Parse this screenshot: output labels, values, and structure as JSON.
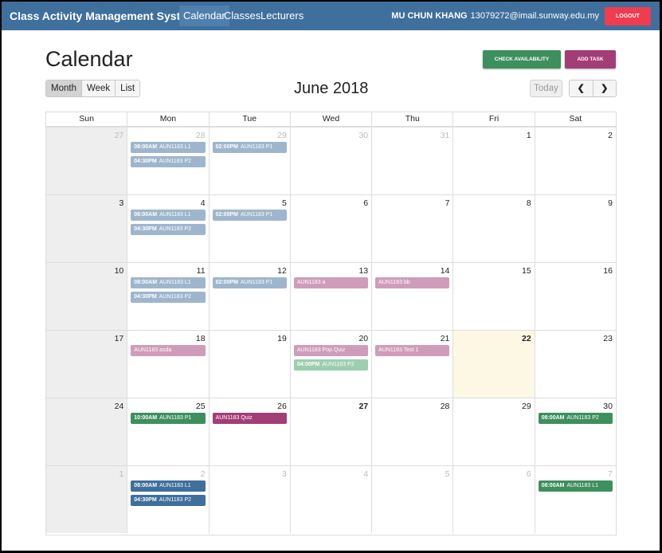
{
  "navbar": {
    "brand": "Class Activity Management System",
    "links": [
      "Calendar",
      "Classes",
      "Lecturers"
    ],
    "user_name": "MU CHUN KHANG",
    "user_email": "13079272@imail.sunway.edu.my",
    "logout_label": "LOGOUT"
  },
  "header": {
    "title": "Calendar",
    "check_availability_label": "CHECK AVAILABILITY",
    "add_task_label": "ADD TASK"
  },
  "toolbar": {
    "views": [
      "Month",
      "Week",
      "List"
    ],
    "active_view": "Month",
    "month_title": "June 2018",
    "today_label": "Today",
    "prev_icon": "chevron-left-icon",
    "next_icon": "chevron-right-icon"
  },
  "calendar": {
    "days_of_week": [
      "Sun",
      "Mon",
      "Tue",
      "Wed",
      "Thu",
      "Fri",
      "Sat"
    ],
    "weeks": [
      [
        {
          "num": "27",
          "other": true,
          "events": []
        },
        {
          "num": "28",
          "other": true,
          "events": [
            {
              "time": "08:00AM",
              "title": "AUN1183 L1",
              "color": "lightblue"
            },
            {
              "time": "04:30PM",
              "title": "AUN1183 P2",
              "color": "lightblue"
            }
          ]
        },
        {
          "num": "29",
          "other": true,
          "events": [
            {
              "time": "02:00PM",
              "title": "AUN1183 P1",
              "color": "lightblue"
            }
          ]
        },
        {
          "num": "30",
          "other": true,
          "events": []
        },
        {
          "num": "31",
          "other": true,
          "events": []
        },
        {
          "num": "1",
          "events": []
        },
        {
          "num": "2",
          "events": []
        }
      ],
      [
        {
          "num": "3",
          "events": []
        },
        {
          "num": "4",
          "events": [
            {
              "time": "08:00AM",
              "title": "AUN1183 L1",
              "color": "lightblue"
            },
            {
              "time": "04:30PM",
              "title": "AUN1183 P2",
              "color": "lightblue"
            }
          ]
        },
        {
          "num": "5",
          "events": [
            {
              "time": "02:00PM",
              "title": "AUN1183 P1",
              "color": "lightblue"
            }
          ]
        },
        {
          "num": "6",
          "events": []
        },
        {
          "num": "7",
          "events": []
        },
        {
          "num": "8",
          "events": []
        },
        {
          "num": "9",
          "events": []
        }
      ],
      [
        {
          "num": "10",
          "events": []
        },
        {
          "num": "11",
          "events": [
            {
              "time": "08:00AM",
              "title": "AUN1183 L1",
              "color": "lightblue"
            },
            {
              "time": "04:30PM",
              "title": "AUN1183 P2",
              "color": "lightblue"
            }
          ]
        },
        {
          "num": "12",
          "events": [
            {
              "time": "02:00PM",
              "title": "AUN1183 P1",
              "color": "lightblue"
            }
          ]
        },
        {
          "num": "13",
          "events": [
            {
              "time": "",
              "title": "AUN1183 a",
              "color": "pink"
            }
          ]
        },
        {
          "num": "14",
          "events": [
            {
              "time": "",
              "title": "AUN1183 bb",
              "color": "pink"
            }
          ]
        },
        {
          "num": "15",
          "events": []
        },
        {
          "num": "16",
          "events": []
        }
      ],
      [
        {
          "num": "17",
          "events": []
        },
        {
          "num": "18",
          "events": [
            {
              "time": "",
              "title": "AUN1183 asda",
              "color": "pink"
            }
          ]
        },
        {
          "num": "19",
          "events": []
        },
        {
          "num": "20",
          "events": [
            {
              "time": "",
              "title": "AUN1183 Pop Quiz",
              "color": "pink"
            },
            {
              "time": "04:00PM",
              "title": "AUN1183 P2",
              "color": "lightgreen"
            }
          ]
        },
        {
          "num": "21",
          "events": [
            {
              "time": "",
              "title": "AUN1183 Test 1",
              "color": "pink"
            }
          ]
        },
        {
          "num": "22",
          "today": true,
          "bold": true,
          "events": []
        },
        {
          "num": "23",
          "events": []
        }
      ],
      [
        {
          "num": "24",
          "events": []
        },
        {
          "num": "25",
          "events": [
            {
              "time": "10:00AM",
              "title": "AUN1183 P1",
              "color": "green"
            }
          ]
        },
        {
          "num": "26",
          "events": [
            {
              "time": "",
              "title": "AUN1183 Quiz",
              "color": "purple"
            }
          ]
        },
        {
          "num": "27",
          "bold": true,
          "events": []
        },
        {
          "num": "28",
          "events": []
        },
        {
          "num": "29",
          "events": []
        },
        {
          "num": "30",
          "events": [
            {
              "time": "08:00AM",
              "title": "AUN1183 P2",
              "color": "green"
            }
          ]
        }
      ],
      [
        {
          "num": "1",
          "other": true,
          "events": []
        },
        {
          "num": "2",
          "other": true,
          "events": [
            {
              "time": "08:00AM",
              "title": "AUN1183 L1",
              "color": "blue"
            },
            {
              "time": "04:30PM",
              "title": "AUN1183 P2",
              "color": "blue"
            }
          ]
        },
        {
          "num": "3",
          "other": true,
          "events": []
        },
        {
          "num": "4",
          "other": true,
          "events": []
        },
        {
          "num": "5",
          "other": true,
          "events": []
        },
        {
          "num": "6",
          "other": true,
          "events": []
        },
        {
          "num": "7",
          "other": true,
          "events": [
            {
              "time": "08:00AM",
              "title": "AUN1183 L1",
              "color": "green"
            }
          ]
        }
      ]
    ]
  },
  "colors": {
    "navbar": "#3f6f9d",
    "logout": "#f03c4f",
    "check_availability": "#3e8f5e",
    "add_task": "#a33d76",
    "lightblue": "#9eb6cd",
    "pink": "#cf9db9",
    "lightgreen": "#9ccfae",
    "green": "#3e8f5e",
    "purple": "#a33d76",
    "blue": "#3e6f9d",
    "today": "#fcf8e3"
  }
}
